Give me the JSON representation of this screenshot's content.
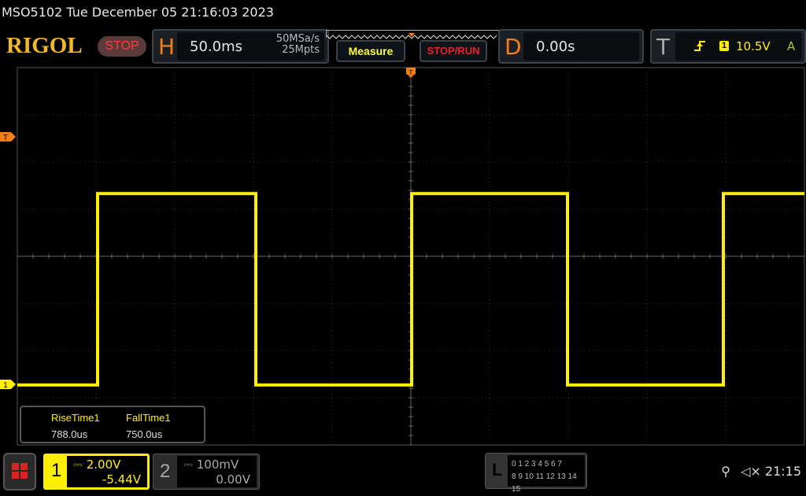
{
  "header": {
    "title": "MSO5102  Tue December 05 21:16:03 2023",
    "logo": "RIGOL",
    "run_state": "STOP"
  },
  "horizontal": {
    "letter": "H",
    "timebase": "50.0ms",
    "sample_rate": "50MSa/s",
    "memory_depth": "25Mpts"
  },
  "buttons": {
    "measure": "Measure",
    "stop_run": "STOP/RUN"
  },
  "delay": {
    "letter": "D",
    "value": "0.00s"
  },
  "trigger": {
    "letter": "T",
    "edge": "rising-edge-icon",
    "source": "1",
    "level": "10.5V",
    "mode": "A"
  },
  "markers": {
    "trigger_level": "T",
    "channel1": "1"
  },
  "measurements": [
    {
      "name": "RiseTime1",
      "value": "788.0us"
    },
    {
      "name": "FallTime1",
      "value": "750.0us"
    }
  ],
  "channels": [
    {
      "num": "1",
      "scale": "2.00V",
      "offset": "-5.44V",
      "coupling": "dc-icon",
      "color": "#ffef00"
    },
    {
      "num": "2",
      "scale": "100mV",
      "offset": "0.00V",
      "coupling": "dc-icon",
      "color": "#777777"
    }
  ],
  "logic": {
    "letter": "L",
    "row1": "0 1 2 3  4 5 6 7",
    "row2": "8 9 10 11 12 13 14 15"
  },
  "status": {
    "usb": "usb-icon",
    "sound": "mute-icon",
    "time": "21:15"
  },
  "waveform": {
    "color": "#ffef00",
    "edges": [
      1.02,
      3.03,
      5.01,
      6.99,
      8.97
    ],
    "high_div": 1.33,
    "low_div": -2.73,
    "start_level": "low"
  }
}
